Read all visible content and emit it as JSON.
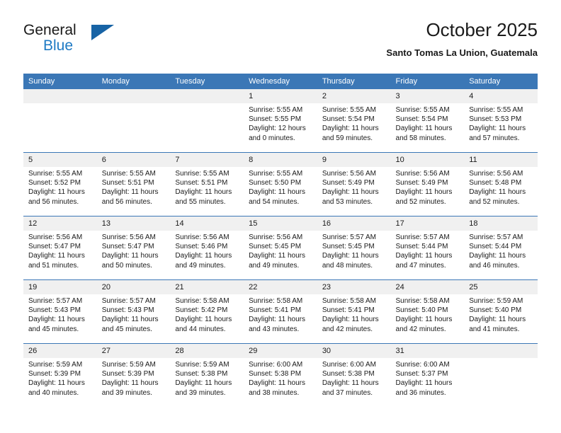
{
  "brand": {
    "name_line1": "General",
    "name_line2": "Blue",
    "triangle_icon": "triangle-icon",
    "accent_color": "#1e7ac4",
    "dark_blue": "#1763a5"
  },
  "header": {
    "title": "October 2025",
    "subtitle": "Santo Tomas La Union, Guatemala"
  },
  "theme": {
    "header_blue": "#3b77b6",
    "daynum_band": "#f0f0f0",
    "text": "#1a1a1a"
  },
  "weekdays": [
    "Sunday",
    "Monday",
    "Tuesday",
    "Wednesday",
    "Thursday",
    "Friday",
    "Saturday"
  ],
  "weeks": [
    [
      {
        "day": "",
        "sunrise": "",
        "sunset": "",
        "daylight": "",
        "daylight2": ""
      },
      {
        "day": "",
        "sunrise": "",
        "sunset": "",
        "daylight": "",
        "daylight2": ""
      },
      {
        "day": "",
        "sunrise": "",
        "sunset": "",
        "daylight": "",
        "daylight2": ""
      },
      {
        "day": "1",
        "sunrise": "Sunrise: 5:55 AM",
        "sunset": "Sunset: 5:55 PM",
        "daylight": "Daylight: 12 hours",
        "daylight2": "and 0 minutes."
      },
      {
        "day": "2",
        "sunrise": "Sunrise: 5:55 AM",
        "sunset": "Sunset: 5:54 PM",
        "daylight": "Daylight: 11 hours",
        "daylight2": "and 59 minutes."
      },
      {
        "day": "3",
        "sunrise": "Sunrise: 5:55 AM",
        "sunset": "Sunset: 5:54 PM",
        "daylight": "Daylight: 11 hours",
        "daylight2": "and 58 minutes."
      },
      {
        "day": "4",
        "sunrise": "Sunrise: 5:55 AM",
        "sunset": "Sunset: 5:53 PM",
        "daylight": "Daylight: 11 hours",
        "daylight2": "and 57 minutes."
      }
    ],
    [
      {
        "day": "5",
        "sunrise": "Sunrise: 5:55 AM",
        "sunset": "Sunset: 5:52 PM",
        "daylight": "Daylight: 11 hours",
        "daylight2": "and 56 minutes."
      },
      {
        "day": "6",
        "sunrise": "Sunrise: 5:55 AM",
        "sunset": "Sunset: 5:51 PM",
        "daylight": "Daylight: 11 hours",
        "daylight2": "and 56 minutes."
      },
      {
        "day": "7",
        "sunrise": "Sunrise: 5:55 AM",
        "sunset": "Sunset: 5:51 PM",
        "daylight": "Daylight: 11 hours",
        "daylight2": "and 55 minutes."
      },
      {
        "day": "8",
        "sunrise": "Sunrise: 5:55 AM",
        "sunset": "Sunset: 5:50 PM",
        "daylight": "Daylight: 11 hours",
        "daylight2": "and 54 minutes."
      },
      {
        "day": "9",
        "sunrise": "Sunrise: 5:56 AM",
        "sunset": "Sunset: 5:49 PM",
        "daylight": "Daylight: 11 hours",
        "daylight2": "and 53 minutes."
      },
      {
        "day": "10",
        "sunrise": "Sunrise: 5:56 AM",
        "sunset": "Sunset: 5:49 PM",
        "daylight": "Daylight: 11 hours",
        "daylight2": "and 52 minutes."
      },
      {
        "day": "11",
        "sunrise": "Sunrise: 5:56 AM",
        "sunset": "Sunset: 5:48 PM",
        "daylight": "Daylight: 11 hours",
        "daylight2": "and 52 minutes."
      }
    ],
    [
      {
        "day": "12",
        "sunrise": "Sunrise: 5:56 AM",
        "sunset": "Sunset: 5:47 PM",
        "daylight": "Daylight: 11 hours",
        "daylight2": "and 51 minutes."
      },
      {
        "day": "13",
        "sunrise": "Sunrise: 5:56 AM",
        "sunset": "Sunset: 5:47 PM",
        "daylight": "Daylight: 11 hours",
        "daylight2": "and 50 minutes."
      },
      {
        "day": "14",
        "sunrise": "Sunrise: 5:56 AM",
        "sunset": "Sunset: 5:46 PM",
        "daylight": "Daylight: 11 hours",
        "daylight2": "and 49 minutes."
      },
      {
        "day": "15",
        "sunrise": "Sunrise: 5:56 AM",
        "sunset": "Sunset: 5:45 PM",
        "daylight": "Daylight: 11 hours",
        "daylight2": "and 49 minutes."
      },
      {
        "day": "16",
        "sunrise": "Sunrise: 5:57 AM",
        "sunset": "Sunset: 5:45 PM",
        "daylight": "Daylight: 11 hours",
        "daylight2": "and 48 minutes."
      },
      {
        "day": "17",
        "sunrise": "Sunrise: 5:57 AM",
        "sunset": "Sunset: 5:44 PM",
        "daylight": "Daylight: 11 hours",
        "daylight2": "and 47 minutes."
      },
      {
        "day": "18",
        "sunrise": "Sunrise: 5:57 AM",
        "sunset": "Sunset: 5:44 PM",
        "daylight": "Daylight: 11 hours",
        "daylight2": "and 46 minutes."
      }
    ],
    [
      {
        "day": "19",
        "sunrise": "Sunrise: 5:57 AM",
        "sunset": "Sunset: 5:43 PM",
        "daylight": "Daylight: 11 hours",
        "daylight2": "and 45 minutes."
      },
      {
        "day": "20",
        "sunrise": "Sunrise: 5:57 AM",
        "sunset": "Sunset: 5:43 PM",
        "daylight": "Daylight: 11 hours",
        "daylight2": "and 45 minutes."
      },
      {
        "day": "21",
        "sunrise": "Sunrise: 5:58 AM",
        "sunset": "Sunset: 5:42 PM",
        "daylight": "Daylight: 11 hours",
        "daylight2": "and 44 minutes."
      },
      {
        "day": "22",
        "sunrise": "Sunrise: 5:58 AM",
        "sunset": "Sunset: 5:41 PM",
        "daylight": "Daylight: 11 hours",
        "daylight2": "and 43 minutes."
      },
      {
        "day": "23",
        "sunrise": "Sunrise: 5:58 AM",
        "sunset": "Sunset: 5:41 PM",
        "daylight": "Daylight: 11 hours",
        "daylight2": "and 42 minutes."
      },
      {
        "day": "24",
        "sunrise": "Sunrise: 5:58 AM",
        "sunset": "Sunset: 5:40 PM",
        "daylight": "Daylight: 11 hours",
        "daylight2": "and 42 minutes."
      },
      {
        "day": "25",
        "sunrise": "Sunrise: 5:59 AM",
        "sunset": "Sunset: 5:40 PM",
        "daylight": "Daylight: 11 hours",
        "daylight2": "and 41 minutes."
      }
    ],
    [
      {
        "day": "26",
        "sunrise": "Sunrise: 5:59 AM",
        "sunset": "Sunset: 5:39 PM",
        "daylight": "Daylight: 11 hours",
        "daylight2": "and 40 minutes."
      },
      {
        "day": "27",
        "sunrise": "Sunrise: 5:59 AM",
        "sunset": "Sunset: 5:39 PM",
        "daylight": "Daylight: 11 hours",
        "daylight2": "and 39 minutes."
      },
      {
        "day": "28",
        "sunrise": "Sunrise: 5:59 AM",
        "sunset": "Sunset: 5:38 PM",
        "daylight": "Daylight: 11 hours",
        "daylight2": "and 39 minutes."
      },
      {
        "day": "29",
        "sunrise": "Sunrise: 6:00 AM",
        "sunset": "Sunset: 5:38 PM",
        "daylight": "Daylight: 11 hours",
        "daylight2": "and 38 minutes."
      },
      {
        "day": "30",
        "sunrise": "Sunrise: 6:00 AM",
        "sunset": "Sunset: 5:38 PM",
        "daylight": "Daylight: 11 hours",
        "daylight2": "and 37 minutes."
      },
      {
        "day": "31",
        "sunrise": "Sunrise: 6:00 AM",
        "sunset": "Sunset: 5:37 PM",
        "daylight": "Daylight: 11 hours",
        "daylight2": "and 36 minutes."
      },
      {
        "day": "",
        "sunrise": "",
        "sunset": "",
        "daylight": "",
        "daylight2": ""
      }
    ]
  ]
}
